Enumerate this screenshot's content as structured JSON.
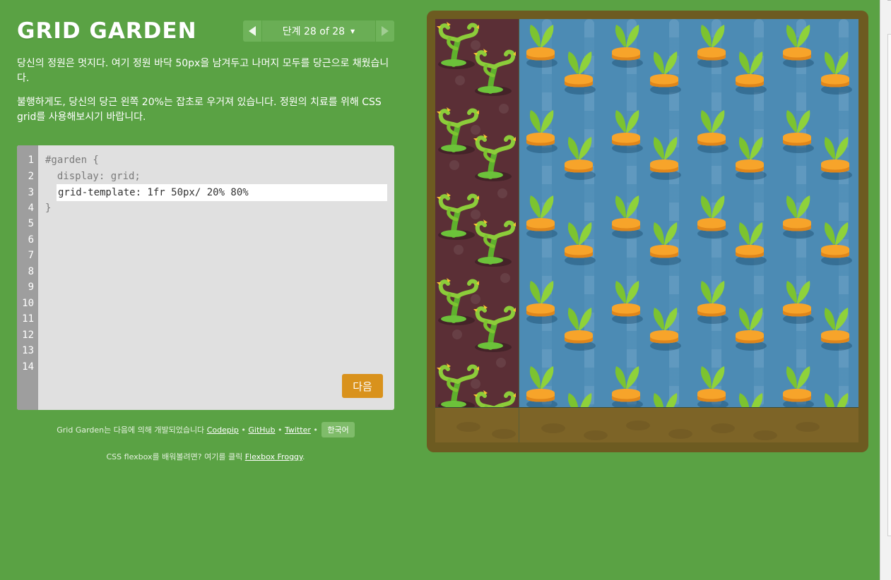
{
  "header": {
    "title": "GRID GARDEN",
    "level_label": "단계 28 of 28",
    "caret": "▼"
  },
  "instructions": {
    "p1": "당신의 정원은 멋지다. 여기 정원 바닥 50px을 남겨두고 나머지 모두를 당근으로 채웠습니다.",
    "p2": "불행하게도, 당신의 당근 왼쪽 20%는 잡초로 우거져 있습니다. 정원의 치료를 위해 CSS grid를 사용해보시기 바랍니다."
  },
  "editor": {
    "line_numbers": [
      "1",
      "2",
      "3",
      "4",
      "5",
      "6",
      "7",
      "8",
      "9",
      "10",
      "11",
      "12",
      "13",
      "14"
    ],
    "line1": "#garden {",
    "line2": "  display: grid;",
    "input_value": "grid-template: 1fr 50px/ 20% 80%",
    "line4": "}",
    "next_label": "다음"
  },
  "credits": {
    "prefix": "Grid Garden는 다음에 의해 개발되었습니다",
    "codepip": "Codepip",
    "github": "GitHub",
    "twitter": "Twitter",
    "sep": "•",
    "language": "한국어"
  },
  "froggy": {
    "prefix": "CSS flexbox를 배워볼려면? 여기를 클릭",
    "link": "Flexbox Froggy",
    "suffix": "."
  },
  "colors": {
    "background": "#5aa244",
    "frame": "#6d5b21",
    "weeds": "#5b2f36",
    "water": "#4c8bb4",
    "soil": "#7d6427",
    "next_button": "#d9921c"
  },
  "icons": [
    "left-arrow-icon",
    "right-arrow-icon",
    "carrot-icon",
    "weed-icon"
  ]
}
